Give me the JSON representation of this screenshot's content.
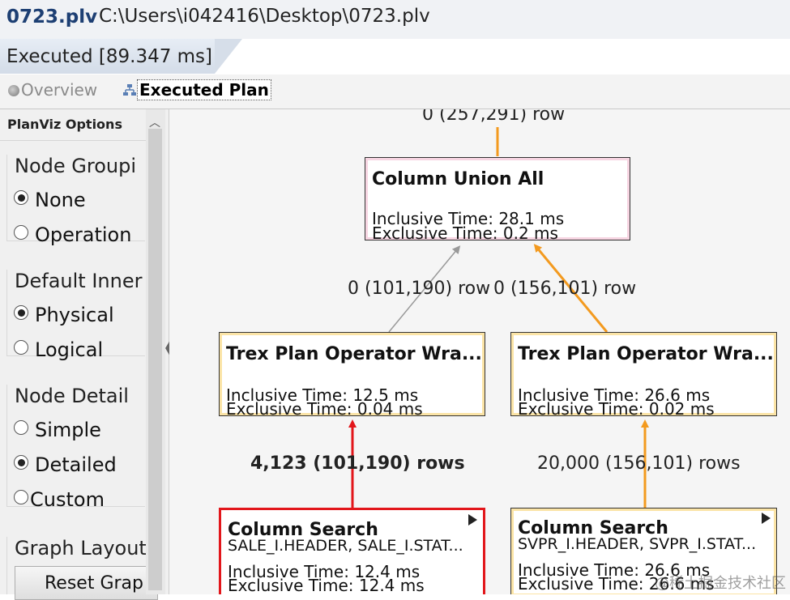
{
  "window": {
    "file_name": "0723.plv",
    "file_path": "C:\\Users\\i042416\\Desktop\\0723.plv"
  },
  "exec_tab": {
    "label": "Executed [89.347 ms]"
  },
  "subtabs": {
    "overview": "Overview",
    "executed_plan": "Executed Plan"
  },
  "panel": {
    "title": "PlanViz Options",
    "groups": [
      {
        "title": "Node Groupi",
        "options": [
          {
            "label": "None",
            "selected": true
          },
          {
            "label": "Operation",
            "selected": false
          }
        ]
      },
      {
        "title": "Default Inner",
        "options": [
          {
            "label": "Physical",
            "selected": true
          },
          {
            "label": "Logical",
            "selected": false
          }
        ]
      },
      {
        "title": "Node Detail",
        "options": [
          {
            "label": "Simple",
            "selected": false
          },
          {
            "label": "Detailed",
            "selected": true
          },
          {
            "label": "Custom",
            "selected": false
          }
        ]
      },
      {
        "title": "Graph Layout"
      }
    ],
    "reset_button": "Reset Grap"
  },
  "graph": {
    "top_edge_label": "0 (257,291) row",
    "nodes": {
      "union": {
        "title": "Column Union All",
        "inclusive": "Inclusive Time: 28.1 ms",
        "exclusive": "Exclusive Time: 0.2 ms"
      },
      "trex_left": {
        "title": "Trex Plan Operator Wra...",
        "inclusive": "Inclusive Time: 12.5 ms",
        "exclusive": "Exclusive Time: 0.04 ms"
      },
      "trex_right": {
        "title": "Trex Plan Operator Wra...",
        "inclusive": "Inclusive Time: 26.6 ms",
        "exclusive": "Exclusive Time: 0.02 ms"
      },
      "search_left": {
        "title": "Column Search",
        "subtitle": "SALE_I.HEADER, SALE_I.STAT...",
        "inclusive": "Inclusive Time: 12.4 ms",
        "exclusive": "Exclusive Time: 12.4 ms"
      },
      "search_right": {
        "title": "Column Search",
        "subtitle": "SVPR_I.HEADER, SVPR_I.STAT...",
        "inclusive": "Inclusive Time: 26.6 ms",
        "exclusive": "Exclusive Time: 26.6 ms"
      }
    },
    "edges": {
      "left_upper": "0 (101,190) row",
      "right_upper": "0 (156,101) row",
      "left_lower": "4,123 (101,190) rows",
      "right_lower": "20,000 (156,101) rows"
    },
    "colors": {
      "orange": "#f39a1f",
      "gray": "#999999",
      "red": "#e2161b"
    }
  },
  "watermark": "@稀土掘金技术社区"
}
